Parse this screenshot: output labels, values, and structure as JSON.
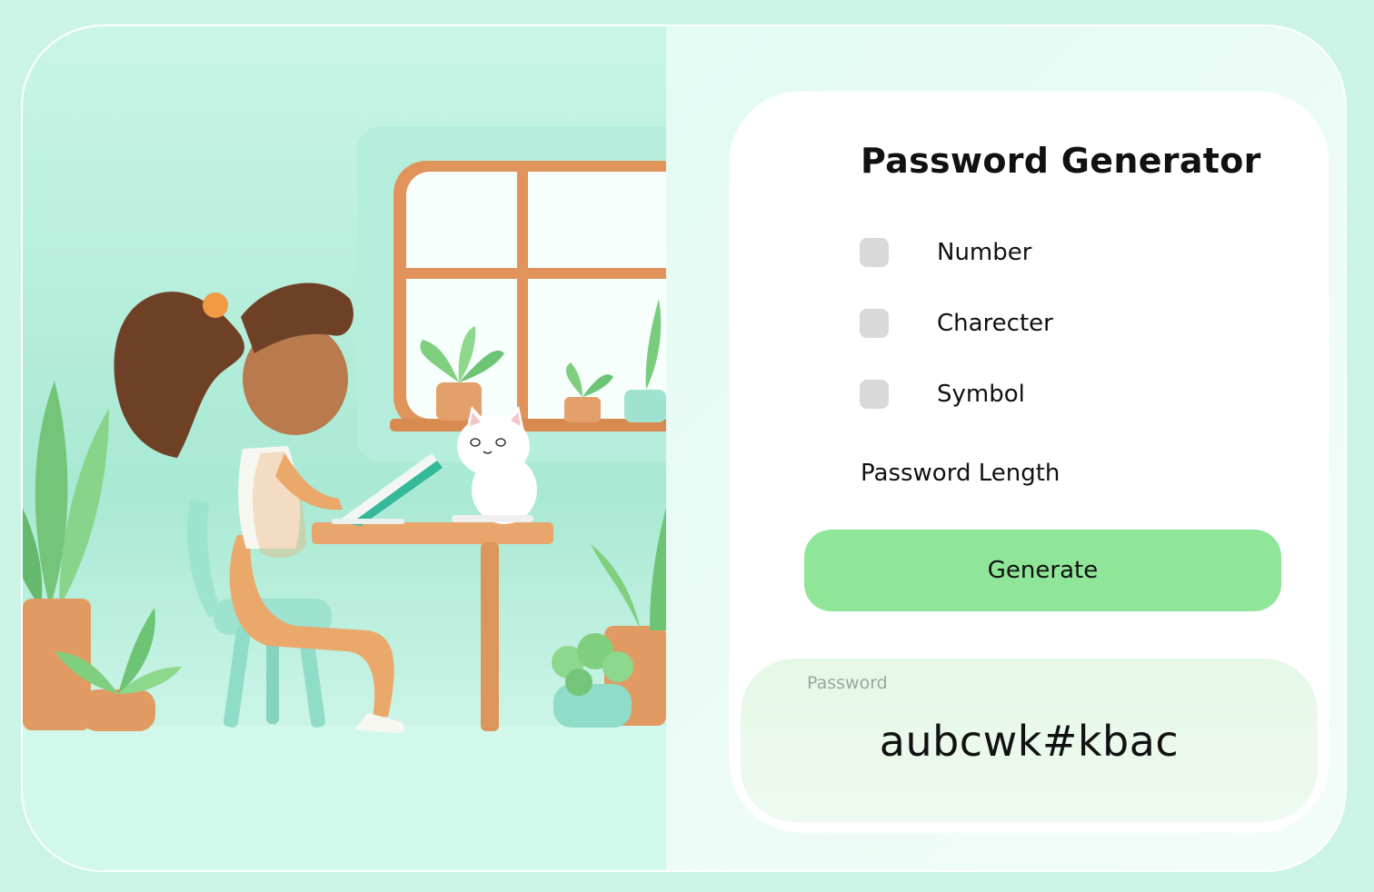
{
  "form": {
    "title": "Password Generator",
    "options": [
      {
        "label": "Number",
        "checked": false
      },
      {
        "label": "Charecter",
        "checked": false
      },
      {
        "label": "Symbol",
        "checked": false
      }
    ],
    "length_label": "Password Length",
    "generate_label": "Generate"
  },
  "output": {
    "caption": "Password",
    "value": "aubcwk#kbac"
  },
  "colors": {
    "background": "#cbf3e6",
    "button": "#8fe598",
    "checkbox": "#d9d9d9",
    "output_panel": "#e5f8e7"
  }
}
